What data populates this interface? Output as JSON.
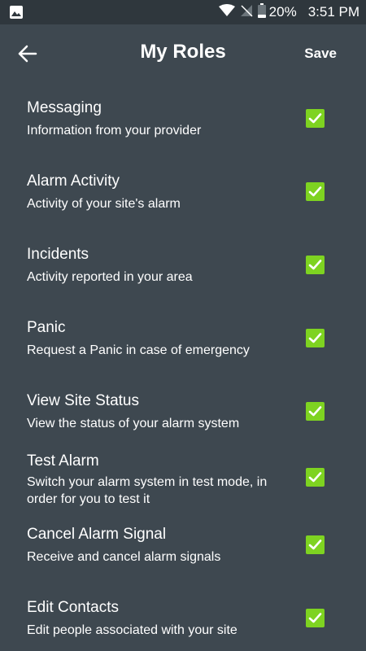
{
  "status_bar": {
    "left_icon": "image-icon",
    "battery": "20%",
    "time": "3:51 PM"
  },
  "header": {
    "title": "My Roles",
    "save_label": "Save",
    "back_icon": "arrow-left-icon"
  },
  "roles": [
    {
      "title": "Messaging",
      "description": "Information from your provider",
      "checked": true
    },
    {
      "title": "Alarm Activity",
      "description": "Activity of your site's alarm",
      "checked": true
    },
    {
      "title": "Incidents",
      "description": "Activity reported in your area",
      "checked": true
    },
    {
      "title": "Panic",
      "description": "Request a Panic in case of emergency",
      "checked": true
    },
    {
      "title": "View Site Status",
      "description": "View the status of your alarm system",
      "checked": true
    },
    {
      "title": "Test Alarm",
      "description": "Switch your alarm system in test mode, in order for you to test it",
      "checked": true
    },
    {
      "title": "Cancel Alarm Signal",
      "description": "Receive and cancel alarm signals",
      "checked": true
    },
    {
      "title": "Edit Contacts",
      "description": "Edit people associated with your site",
      "checked": true
    }
  ],
  "colors": {
    "background": "#3e4850",
    "status_bar": "#2f373d",
    "checkbox": "#7ed321"
  }
}
